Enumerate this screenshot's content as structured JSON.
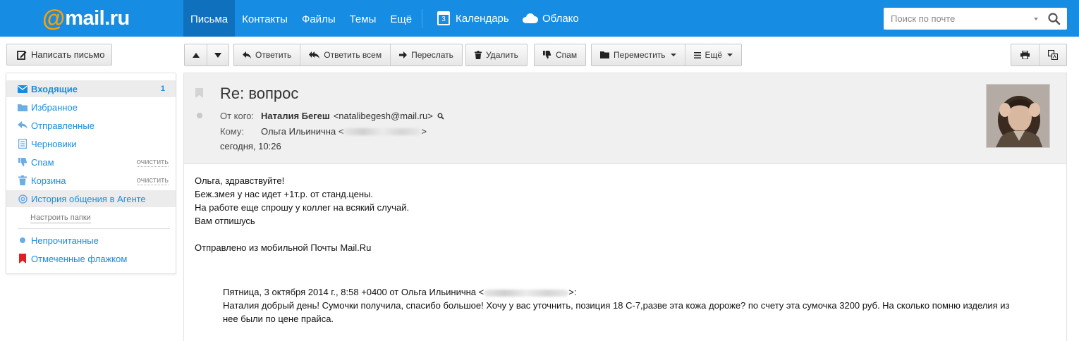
{
  "header": {
    "logo_at": "@",
    "logo_text": "mail.ru",
    "nav": [
      "Письма",
      "Контакты",
      "Файлы",
      "Темы",
      "Ещё"
    ],
    "calendar_label": "Календарь",
    "calendar_day": "3",
    "cloud_label": "Облако",
    "search_placeholder": "Поиск по почте"
  },
  "compose_label": "Написать письмо",
  "folders": [
    {
      "label": "Входящие",
      "count": "1",
      "icon": "envelope-icon"
    },
    {
      "label": "Избранное",
      "icon": "folder-icon"
    },
    {
      "label": "Отправленные",
      "icon": "reply-icon"
    },
    {
      "label": "Черновики",
      "icon": "draft-icon"
    },
    {
      "label": "Спам",
      "action": "очистить",
      "icon": "thumbs-down-icon"
    },
    {
      "label": "Корзина",
      "action": "очистить",
      "icon": "trash-icon"
    },
    {
      "label": "История общения в Агенте",
      "icon": "agent-icon"
    }
  ],
  "setup_folders_label": "Настроить папки",
  "filters": [
    {
      "label": "Непрочитанные",
      "icon": "unread-dot-icon"
    },
    {
      "label": "Отмеченные флажком",
      "icon": "flag-icon"
    }
  ],
  "toolbar": {
    "reply": "Ответить",
    "reply_all": "Ответить всем",
    "forward": "Переслать",
    "delete": "Удалить",
    "spam": "Спам",
    "move": "Переместить",
    "more": "Ещё"
  },
  "message": {
    "subject": "Re: вопрос",
    "from_label": "От кого:",
    "from_name": "Наталия Бегеш",
    "from_email": "<natalibegesh@mail.ru>",
    "to_label": "Кому:",
    "to_name": "Ольга Ильинична <",
    "to_end": ">",
    "date": "сегодня, 10:26",
    "body_lines": [
      "Ольга, здравствуйте!",
      "Беж.змея у нас идет +1т.р. от станд.цены.",
      "На работе еще спрошу у коллег на всякий случай.",
      "Вам отпишусь",
      "",
      "Отправлено из мобильной Почты Mail.Ru"
    ],
    "quote_header": "Пятница, 3 октября 2014 г., 8:58 +0400 от Ольга Ильинична <",
    "quote_header_end": ">:",
    "quote_text": "Наталия добрый день! Сумочки получила, спасибо большое! Хочу у вас уточнить, позиция 18 С-7,разве эта кожа дороже? по счету эта сумочка 3200 руб. На сколько помню изделия из нее были по цене прайса."
  },
  "colors": {
    "topbar": "#168de2",
    "nav_active": "#0f70bd",
    "logo_accent": "#ff9e00",
    "link": "#168de2",
    "flag_red": "#e02020"
  }
}
